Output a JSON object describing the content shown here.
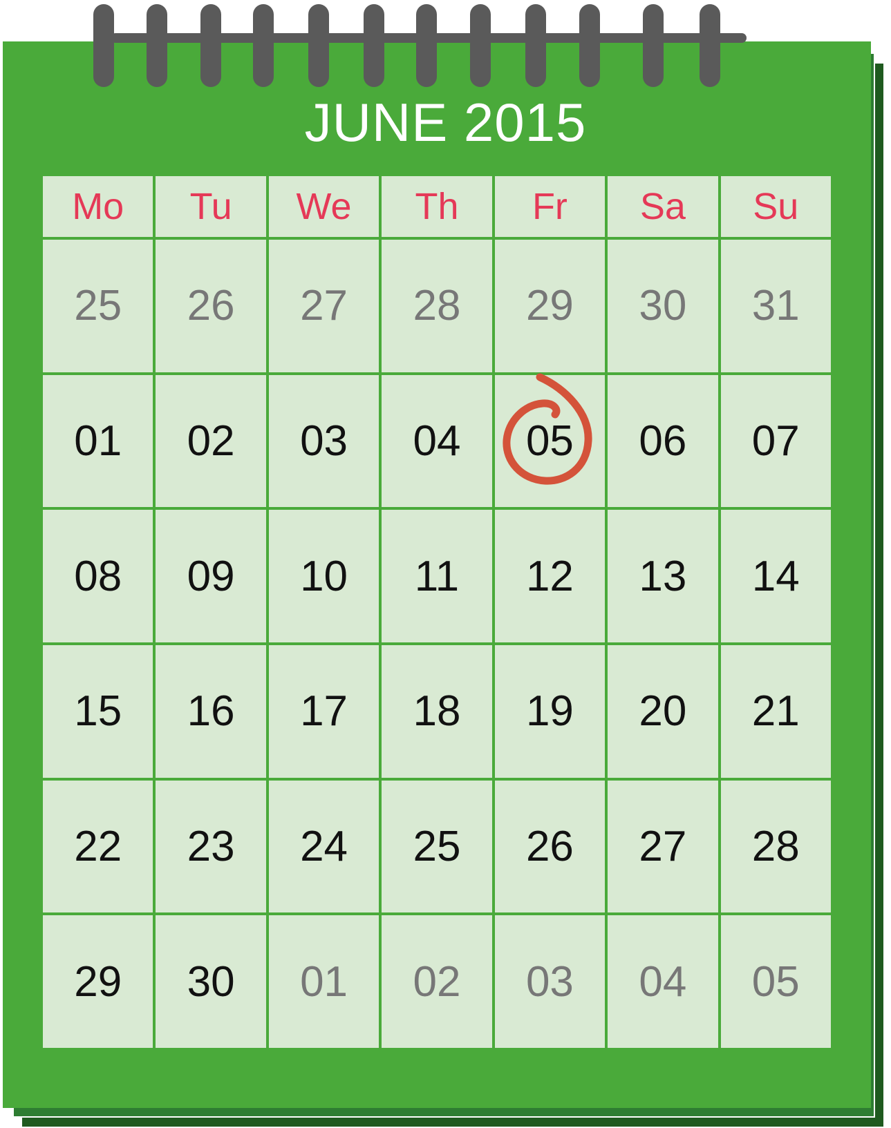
{
  "calendar": {
    "title": "JUNE 2015",
    "weekdays": [
      "Mo",
      "Tu",
      "We",
      "Th",
      "Fr",
      "Sa",
      "Su"
    ],
    "weeks": [
      [
        {
          "label": "25",
          "muted": true
        },
        {
          "label": "26",
          "muted": true
        },
        {
          "label": "27",
          "muted": true
        },
        {
          "label": "28",
          "muted": true
        },
        {
          "label": "29",
          "muted": true
        },
        {
          "label": "30",
          "muted": true
        },
        {
          "label": "31",
          "muted": true
        }
      ],
      [
        {
          "label": "01",
          "muted": false
        },
        {
          "label": "02",
          "muted": false
        },
        {
          "label": "03",
          "muted": false
        },
        {
          "label": "04",
          "muted": false
        },
        {
          "label": "05",
          "muted": false,
          "circled": true
        },
        {
          "label": "06",
          "muted": false
        },
        {
          "label": "07",
          "muted": false
        }
      ],
      [
        {
          "label": "08",
          "muted": false
        },
        {
          "label": "09",
          "muted": false
        },
        {
          "label": "10",
          "muted": false
        },
        {
          "label": "11",
          "muted": false
        },
        {
          "label": "12",
          "muted": false
        },
        {
          "label": "13",
          "muted": false
        },
        {
          "label": "14",
          "muted": false
        }
      ],
      [
        {
          "label": "15",
          "muted": false
        },
        {
          "label": "16",
          "muted": false
        },
        {
          "label": "17",
          "muted": false
        },
        {
          "label": "18",
          "muted": false
        },
        {
          "label": "19",
          "muted": false
        },
        {
          "label": "20",
          "muted": false
        },
        {
          "label": "21",
          "muted": false
        }
      ],
      [
        {
          "label": "22",
          "muted": false
        },
        {
          "label": "23",
          "muted": false
        },
        {
          "label": "24",
          "muted": false
        },
        {
          "label": "25",
          "muted": false
        },
        {
          "label": "26",
          "muted": false
        },
        {
          "label": "27",
          "muted": false
        },
        {
          "label": "28",
          "muted": false
        }
      ],
      [
        {
          "label": "29",
          "muted": false
        },
        {
          "label": "30",
          "muted": false
        },
        {
          "label": "01",
          "muted": true
        },
        {
          "label": "02",
          "muted": true
        },
        {
          "label": "03",
          "muted": true
        },
        {
          "label": "04",
          "muted": true
        },
        {
          "label": "05",
          "muted": true
        }
      ]
    ]
  },
  "colors": {
    "calendar_green": "#4aaa3a",
    "cell_fill": "#d9ead3",
    "weekday_text": "#e53957",
    "circle_mark": "#d4533a",
    "binding_rings": "#5a5a5a"
  },
  "icons": {
    "binding": "spiral-binding-icon",
    "highlight": "hand-drawn-circle-icon"
  }
}
